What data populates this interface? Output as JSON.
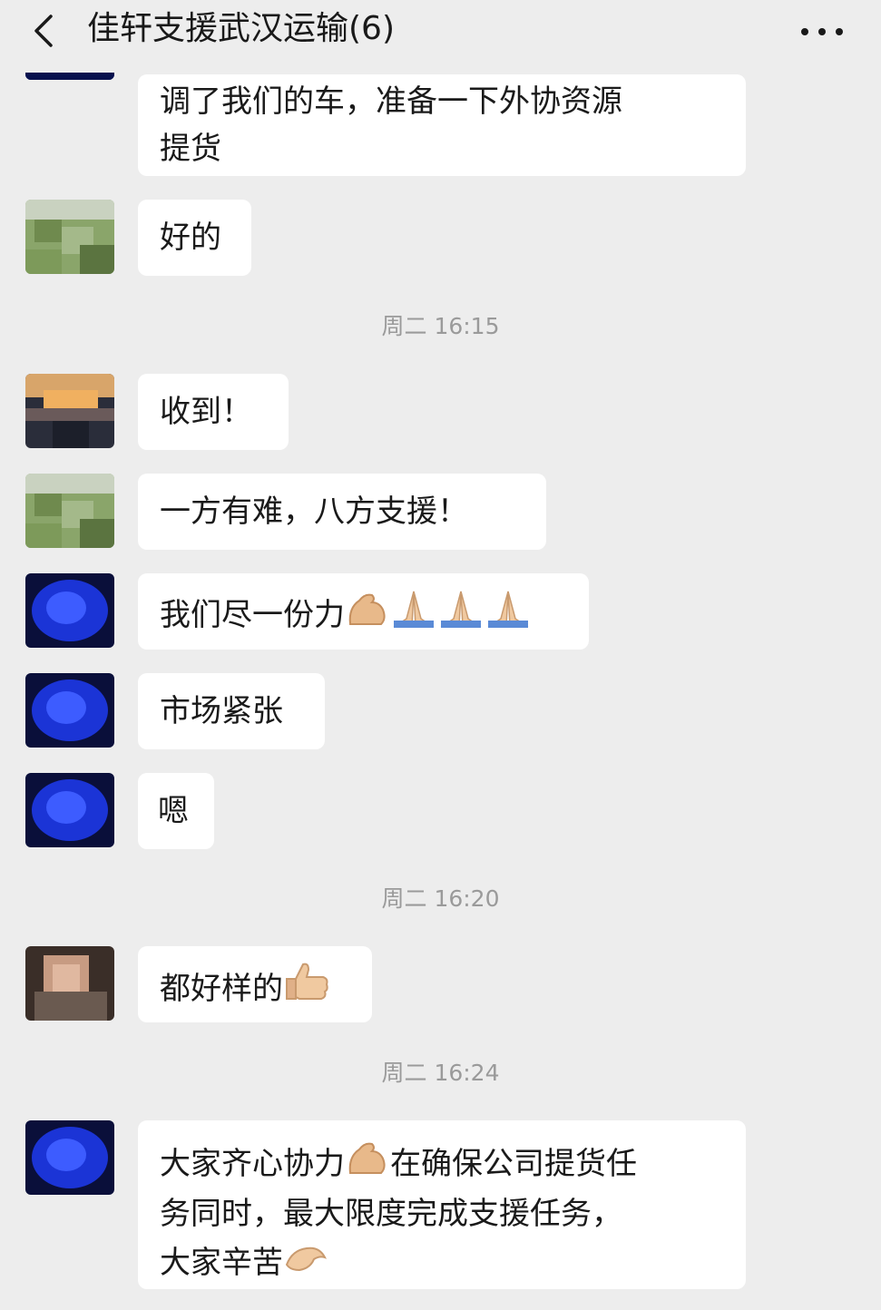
{
  "header": {
    "title": "佳轩支援武汉运输(6)"
  },
  "messages": {
    "m0": {
      "line1": "调了我们的车，准备一下外协资源",
      "line2": "提货"
    },
    "m1": "好的",
    "t1": "周二 16:15",
    "m2": "收到！",
    "m3": "一方有难，八方支援！",
    "m4": "我们尽一份力",
    "m5": "市场紧张",
    "m6": "嗯",
    "t2": "周二 16:20",
    "m7": "都好样的",
    "t3": "周二 16:24",
    "m8": {
      "line1a": "大家齐心协力",
      "line1b": "在确保公司提货任",
      "line2": "务同时，最大限度完成支援任务，",
      "line3": "大家辛苦"
    }
  },
  "icons": {
    "back": "chevron-left-icon",
    "more": "more-dots-icon",
    "emoji": [
      "flexed-biceps",
      "folded-hands",
      "thumbs-up",
      "pinched-hand"
    ]
  },
  "colors": {
    "background": "#ededed",
    "bubble": "#ffffff",
    "timestamp": "#9a9a9a"
  }
}
